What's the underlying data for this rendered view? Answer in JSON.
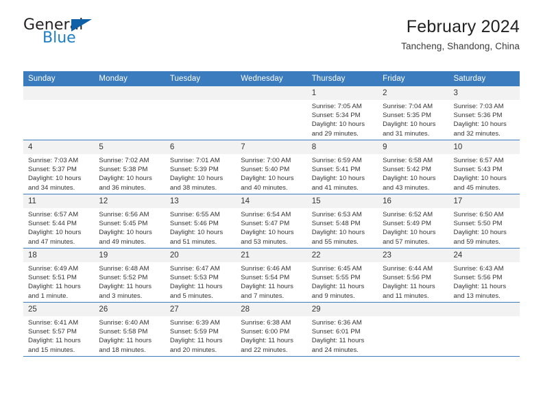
{
  "brand": {
    "name_part1": "General",
    "name_part2": "Blue"
  },
  "header": {
    "title": "February 2024",
    "subtitle": "Tancheng, Shandong, China"
  },
  "colors": {
    "header_blue": "#3a7cbe",
    "logo_blue": "#1f7fc4",
    "logo_triangle": "#1060a8",
    "daynum_band": "#f2f2f2"
  },
  "weekday_headers": [
    "Sunday",
    "Monday",
    "Tuesday",
    "Wednesday",
    "Thursday",
    "Friday",
    "Saturday"
  ],
  "weeks": [
    [
      {
        "day": "",
        "empty": true,
        "sunrise": "",
        "sunset": "",
        "daylight1": "",
        "daylight2": ""
      },
      {
        "day": "",
        "empty": true,
        "sunrise": "",
        "sunset": "",
        "daylight1": "",
        "daylight2": ""
      },
      {
        "day": "",
        "empty": true,
        "sunrise": "",
        "sunset": "",
        "daylight1": "",
        "daylight2": ""
      },
      {
        "day": "",
        "empty": true,
        "sunrise": "",
        "sunset": "",
        "daylight1": "",
        "daylight2": ""
      },
      {
        "day": "1",
        "sunrise": "Sunrise: 7:05 AM",
        "sunset": "Sunset: 5:34 PM",
        "daylight1": "Daylight: 10 hours",
        "daylight2": "and 29 minutes."
      },
      {
        "day": "2",
        "sunrise": "Sunrise: 7:04 AM",
        "sunset": "Sunset: 5:35 PM",
        "daylight1": "Daylight: 10 hours",
        "daylight2": "and 31 minutes."
      },
      {
        "day": "3",
        "sunrise": "Sunrise: 7:03 AM",
        "sunset": "Sunset: 5:36 PM",
        "daylight1": "Daylight: 10 hours",
        "daylight2": "and 32 minutes."
      }
    ],
    [
      {
        "day": "4",
        "sunrise": "Sunrise: 7:03 AM",
        "sunset": "Sunset: 5:37 PM",
        "daylight1": "Daylight: 10 hours",
        "daylight2": "and 34 minutes."
      },
      {
        "day": "5",
        "sunrise": "Sunrise: 7:02 AM",
        "sunset": "Sunset: 5:38 PM",
        "daylight1": "Daylight: 10 hours",
        "daylight2": "and 36 minutes."
      },
      {
        "day": "6",
        "sunrise": "Sunrise: 7:01 AM",
        "sunset": "Sunset: 5:39 PM",
        "daylight1": "Daylight: 10 hours",
        "daylight2": "and 38 minutes."
      },
      {
        "day": "7",
        "sunrise": "Sunrise: 7:00 AM",
        "sunset": "Sunset: 5:40 PM",
        "daylight1": "Daylight: 10 hours",
        "daylight2": "and 40 minutes."
      },
      {
        "day": "8",
        "sunrise": "Sunrise: 6:59 AM",
        "sunset": "Sunset: 5:41 PM",
        "daylight1": "Daylight: 10 hours",
        "daylight2": "and 41 minutes."
      },
      {
        "day": "9",
        "sunrise": "Sunrise: 6:58 AM",
        "sunset": "Sunset: 5:42 PM",
        "daylight1": "Daylight: 10 hours",
        "daylight2": "and 43 minutes."
      },
      {
        "day": "10",
        "sunrise": "Sunrise: 6:57 AM",
        "sunset": "Sunset: 5:43 PM",
        "daylight1": "Daylight: 10 hours",
        "daylight2": "and 45 minutes."
      }
    ],
    [
      {
        "day": "11",
        "sunrise": "Sunrise: 6:57 AM",
        "sunset": "Sunset: 5:44 PM",
        "daylight1": "Daylight: 10 hours",
        "daylight2": "and 47 minutes."
      },
      {
        "day": "12",
        "sunrise": "Sunrise: 6:56 AM",
        "sunset": "Sunset: 5:45 PM",
        "daylight1": "Daylight: 10 hours",
        "daylight2": "and 49 minutes."
      },
      {
        "day": "13",
        "sunrise": "Sunrise: 6:55 AM",
        "sunset": "Sunset: 5:46 PM",
        "daylight1": "Daylight: 10 hours",
        "daylight2": "and 51 minutes."
      },
      {
        "day": "14",
        "sunrise": "Sunrise: 6:54 AM",
        "sunset": "Sunset: 5:47 PM",
        "daylight1": "Daylight: 10 hours",
        "daylight2": "and 53 minutes."
      },
      {
        "day": "15",
        "sunrise": "Sunrise: 6:53 AM",
        "sunset": "Sunset: 5:48 PM",
        "daylight1": "Daylight: 10 hours",
        "daylight2": "and 55 minutes."
      },
      {
        "day": "16",
        "sunrise": "Sunrise: 6:52 AM",
        "sunset": "Sunset: 5:49 PM",
        "daylight1": "Daylight: 10 hours",
        "daylight2": "and 57 minutes."
      },
      {
        "day": "17",
        "sunrise": "Sunrise: 6:50 AM",
        "sunset": "Sunset: 5:50 PM",
        "daylight1": "Daylight: 10 hours",
        "daylight2": "and 59 minutes."
      }
    ],
    [
      {
        "day": "18",
        "sunrise": "Sunrise: 6:49 AM",
        "sunset": "Sunset: 5:51 PM",
        "daylight1": "Daylight: 11 hours",
        "daylight2": "and 1 minute."
      },
      {
        "day": "19",
        "sunrise": "Sunrise: 6:48 AM",
        "sunset": "Sunset: 5:52 PM",
        "daylight1": "Daylight: 11 hours",
        "daylight2": "and 3 minutes."
      },
      {
        "day": "20",
        "sunrise": "Sunrise: 6:47 AM",
        "sunset": "Sunset: 5:53 PM",
        "daylight1": "Daylight: 11 hours",
        "daylight2": "and 5 minutes."
      },
      {
        "day": "21",
        "sunrise": "Sunrise: 6:46 AM",
        "sunset": "Sunset: 5:54 PM",
        "daylight1": "Daylight: 11 hours",
        "daylight2": "and 7 minutes."
      },
      {
        "day": "22",
        "sunrise": "Sunrise: 6:45 AM",
        "sunset": "Sunset: 5:55 PM",
        "daylight1": "Daylight: 11 hours",
        "daylight2": "and 9 minutes."
      },
      {
        "day": "23",
        "sunrise": "Sunrise: 6:44 AM",
        "sunset": "Sunset: 5:56 PM",
        "daylight1": "Daylight: 11 hours",
        "daylight2": "and 11 minutes."
      },
      {
        "day": "24",
        "sunrise": "Sunrise: 6:43 AM",
        "sunset": "Sunset: 5:56 PM",
        "daylight1": "Daylight: 11 hours",
        "daylight2": "and 13 minutes."
      }
    ],
    [
      {
        "day": "25",
        "sunrise": "Sunrise: 6:41 AM",
        "sunset": "Sunset: 5:57 PM",
        "daylight1": "Daylight: 11 hours",
        "daylight2": "and 15 minutes."
      },
      {
        "day": "26",
        "sunrise": "Sunrise: 6:40 AM",
        "sunset": "Sunset: 5:58 PM",
        "daylight1": "Daylight: 11 hours",
        "daylight2": "and 18 minutes."
      },
      {
        "day": "27",
        "sunrise": "Sunrise: 6:39 AM",
        "sunset": "Sunset: 5:59 PM",
        "daylight1": "Daylight: 11 hours",
        "daylight2": "and 20 minutes."
      },
      {
        "day": "28",
        "sunrise": "Sunrise: 6:38 AM",
        "sunset": "Sunset: 6:00 PM",
        "daylight1": "Daylight: 11 hours",
        "daylight2": "and 22 minutes."
      },
      {
        "day": "29",
        "sunrise": "Sunrise: 6:36 AM",
        "sunset": "Sunset: 6:01 PM",
        "daylight1": "Daylight: 11 hours",
        "daylight2": "and 24 minutes."
      },
      {
        "day": "",
        "empty": true,
        "sunrise": "",
        "sunset": "",
        "daylight1": "",
        "daylight2": ""
      },
      {
        "day": "",
        "empty": true,
        "sunrise": "",
        "sunset": "",
        "daylight1": "",
        "daylight2": ""
      }
    ]
  ]
}
